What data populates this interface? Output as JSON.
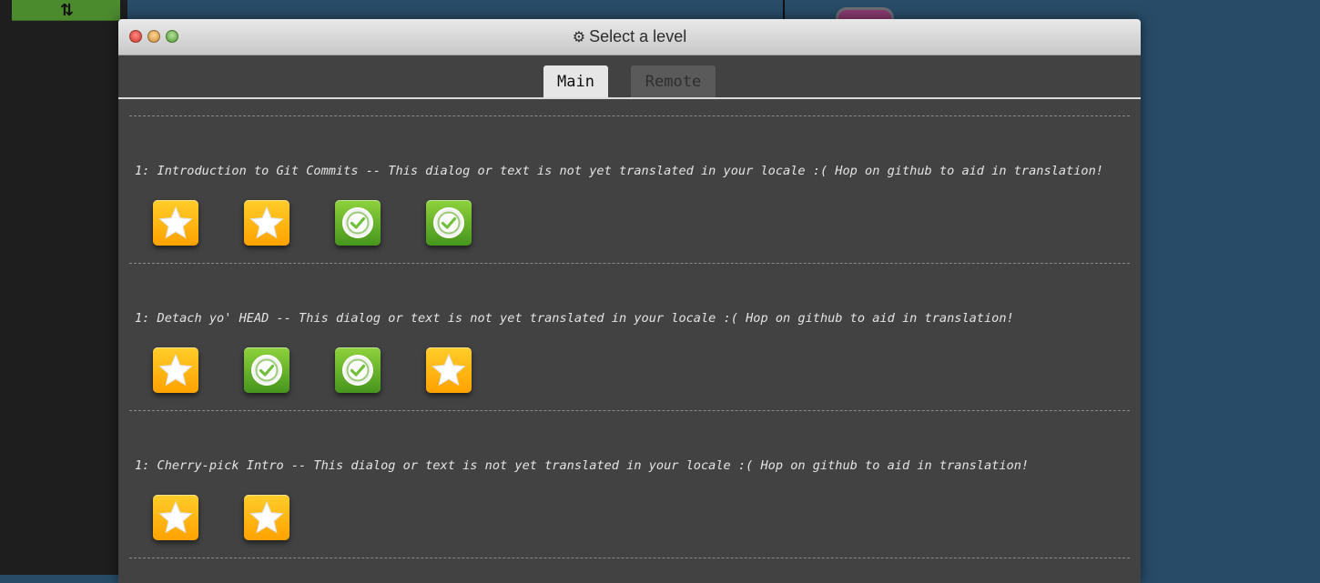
{
  "background_app": {
    "toolbar_button_glyph": "⇅"
  },
  "dialog": {
    "title_icon": "gear-icon",
    "title": "Select a level",
    "tabs": [
      {
        "label": "Main",
        "active": true
      },
      {
        "label": "Remote",
        "active": false
      }
    ],
    "sequences": [
      {
        "title": "1: Introduction to Git Commits -- This dialog or text is not yet translated in your locale :( Hop on github to aid in translation!",
        "levels": [
          "star-icon",
          "star-icon",
          "checkmark-icon",
          "checkmark-icon"
        ]
      },
      {
        "title": "1: Detach yo' HEAD -- This dialog or text is not yet translated in your locale :( Hop on github to aid in translation!",
        "levels": [
          "star-icon",
          "checkmark-icon",
          "checkmark-icon",
          "star-icon"
        ]
      },
      {
        "title": "1: Cherry-pick Intro -- This dialog or text is not yet translated in your locale :( Hop on github to aid in translation!",
        "levels": [
          "star-icon",
          "star-icon"
        ]
      }
    ]
  },
  "colors": {
    "star_tile": "#ffb400",
    "completed_tile": "#5fb12a",
    "dialog_body": "#424242",
    "page_background": "#284c68"
  }
}
